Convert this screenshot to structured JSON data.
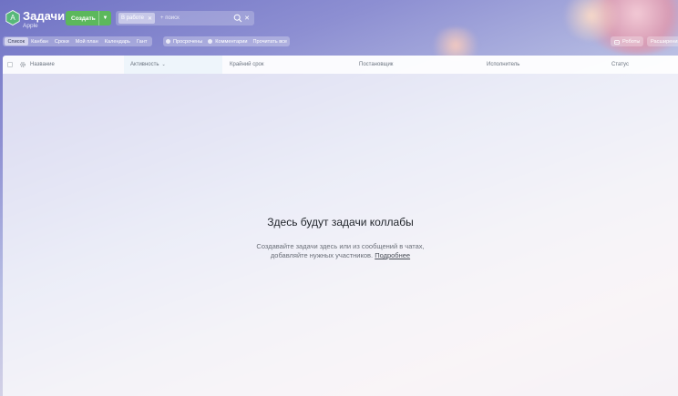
{
  "header": {
    "title": "Задачи",
    "subtitle": "Apple",
    "logo_letter": "A",
    "create_label": "Создать",
    "filter_chip": "В работе",
    "search_placeholder": "+ поиск"
  },
  "toolbar": {
    "views": [
      "Список",
      "Канбан",
      "Сроки",
      "Мой план",
      "Календарь",
      "Гант"
    ],
    "counters": [
      "Просрочены",
      "Комментарии"
    ],
    "read_all": "Прочитать все",
    "robots": "Роботы",
    "extensions": "Расширения"
  },
  "table": {
    "columns": [
      "Название",
      "Активность",
      "Крайний срок",
      "Постановщик",
      "Исполнитель",
      "Статус"
    ]
  },
  "empty_state": {
    "title": "Здесь будут задачи коллабы",
    "line1": "Создавайте задачи здесь или из сообщений в чатах,",
    "line2": "добавляйте нужных участников.",
    "link": "Подробнее"
  },
  "colors": {
    "create_button": "#5cb85c",
    "logo": "#58b87a"
  }
}
